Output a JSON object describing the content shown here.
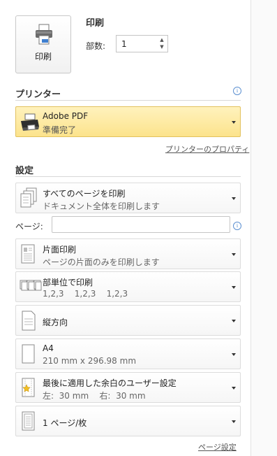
{
  "print": {
    "button_label": "印刷",
    "title": "印刷",
    "copies_label": "部数:",
    "copies_value": "1"
  },
  "printer": {
    "section_title": "プリンター",
    "name": "Adobe PDF",
    "status": "準備完了",
    "properties_link": "プリンターのプロパティ"
  },
  "settings": {
    "section_title": "設定",
    "scope": {
      "title": "すべてのページを印刷",
      "subtitle": "ドキュメント全体を印刷します"
    },
    "pages_label": "ページ:",
    "pages_value": "",
    "sides": {
      "title": "片面印刷",
      "subtitle": "ページの片面のみを印刷します"
    },
    "collate": {
      "title": "部単位で印刷",
      "subtitle": "1,2,3    1,2,3    1,2,3"
    },
    "orientation": {
      "title": "縦方向"
    },
    "paper": {
      "title": "A4",
      "subtitle": "210 mm x 296.98 mm"
    },
    "margins": {
      "title": "最後に適用した余白のユーザー設定",
      "subtitle": "左:  30 mm    右:  30 mm"
    },
    "per_sheet": {
      "title": "1 ページ/枚"
    },
    "page_setup_link": "ページ設定"
  },
  "colors": {
    "highlight_top": "#fff2bd",
    "highlight_bottom": "#fce38c",
    "info_blue": "#5b8fd0"
  }
}
